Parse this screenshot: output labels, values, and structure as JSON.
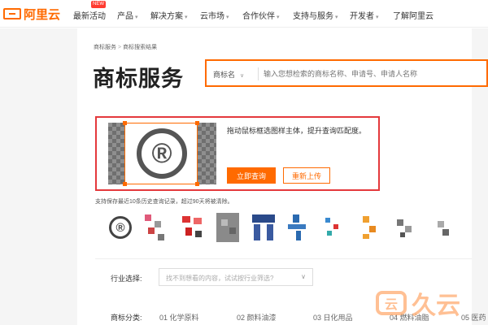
{
  "nav": {
    "logo": "阿里云",
    "new_badge": "NEW",
    "items": [
      {
        "label": "最新活动",
        "caret": false
      },
      {
        "label": "产品",
        "caret": true
      },
      {
        "label": "解决方案",
        "caret": true
      },
      {
        "label": "云市场",
        "caret": true
      },
      {
        "label": "合作伙伴",
        "caret": true
      },
      {
        "label": "支持与服务",
        "caret": true
      },
      {
        "label": "开发者",
        "caret": true
      },
      {
        "label": "了解阿里云",
        "caret": false
      }
    ]
  },
  "breadcrumb": [
    "商标服务",
    "商标搜索结果"
  ],
  "page_title": "商标服务",
  "search": {
    "category": "商标名",
    "placeholder": "输入您想检索的商标名称、申请号、申请人名称"
  },
  "upload": {
    "hint": "拖动鼠标框选图样主体，提升查询匹配度。",
    "query_button": "立即查询",
    "reupload_button": "重新上传",
    "preview_symbol": "®"
  },
  "history": {
    "label": "支持保存最近10条历史查询记录，超过90天将被清除。",
    "first_symbol": "®"
  },
  "filters": {
    "industry_label": "行业选择:",
    "industry_placeholder": "找不到想看的内容，试试按行业筛选?",
    "category_label": "商标分类:",
    "categories": [
      "01 化学原料",
      "02 颜料油漆",
      "03 日化用品",
      "04 燃料油脂",
      "05 医药"
    ]
  },
  "watermark": "久云",
  "colors": {
    "accent": "#ff6a00",
    "highlight_border": "#e4393c"
  }
}
